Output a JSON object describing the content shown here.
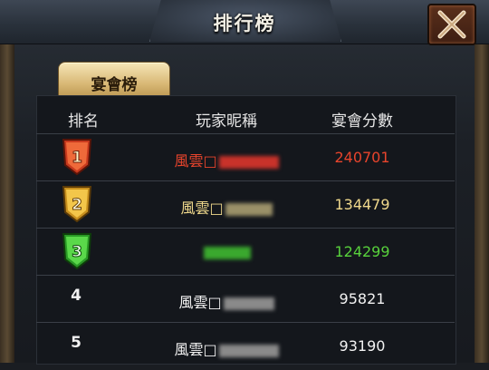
{
  "window": {
    "title": "排行榜",
    "close_icon": "close-x-icon"
  },
  "tabs": [
    {
      "label": "宴會榜",
      "active": true
    }
  ],
  "table": {
    "headers": [
      "排名",
      "玩家昵稱",
      "宴會分數"
    ],
    "rows": [
      {
        "rank": "1",
        "rank_style": "red-banner",
        "name_prefix": "風雲□",
        "name_blurred": true,
        "score": "240701",
        "color": "#e8442c",
        "blur_color": "#c8322a"
      },
      {
        "rank": "2",
        "rank_style": "gold-banner",
        "name_prefix": "風雲□",
        "name_blurred": true,
        "score": "134479",
        "color": "#f0d98c",
        "blur_color": "#9a9068"
      },
      {
        "rank": "3",
        "rank_style": "green-banner",
        "name_prefix": "",
        "name_blurred": true,
        "score": "124299",
        "color": "#58d23c",
        "blur_color": "#3aa82e"
      },
      {
        "rank": "4",
        "rank_style": "plain",
        "name_prefix": "風雲□",
        "name_blurred": true,
        "score": "95821",
        "color": "#f2f2f2",
        "blur_color": "#8a8a8a"
      },
      {
        "rank": "5",
        "rank_style": "plain",
        "name_prefix": "風雲□",
        "name_blurred": true,
        "score": "93190",
        "color": "#f2f2f2",
        "blur_color": "#8a8a8a"
      }
    ]
  },
  "colors": {
    "rank1": "#e24a2a",
    "rank2": "#e8b63a",
    "rank3": "#3cc23a"
  }
}
